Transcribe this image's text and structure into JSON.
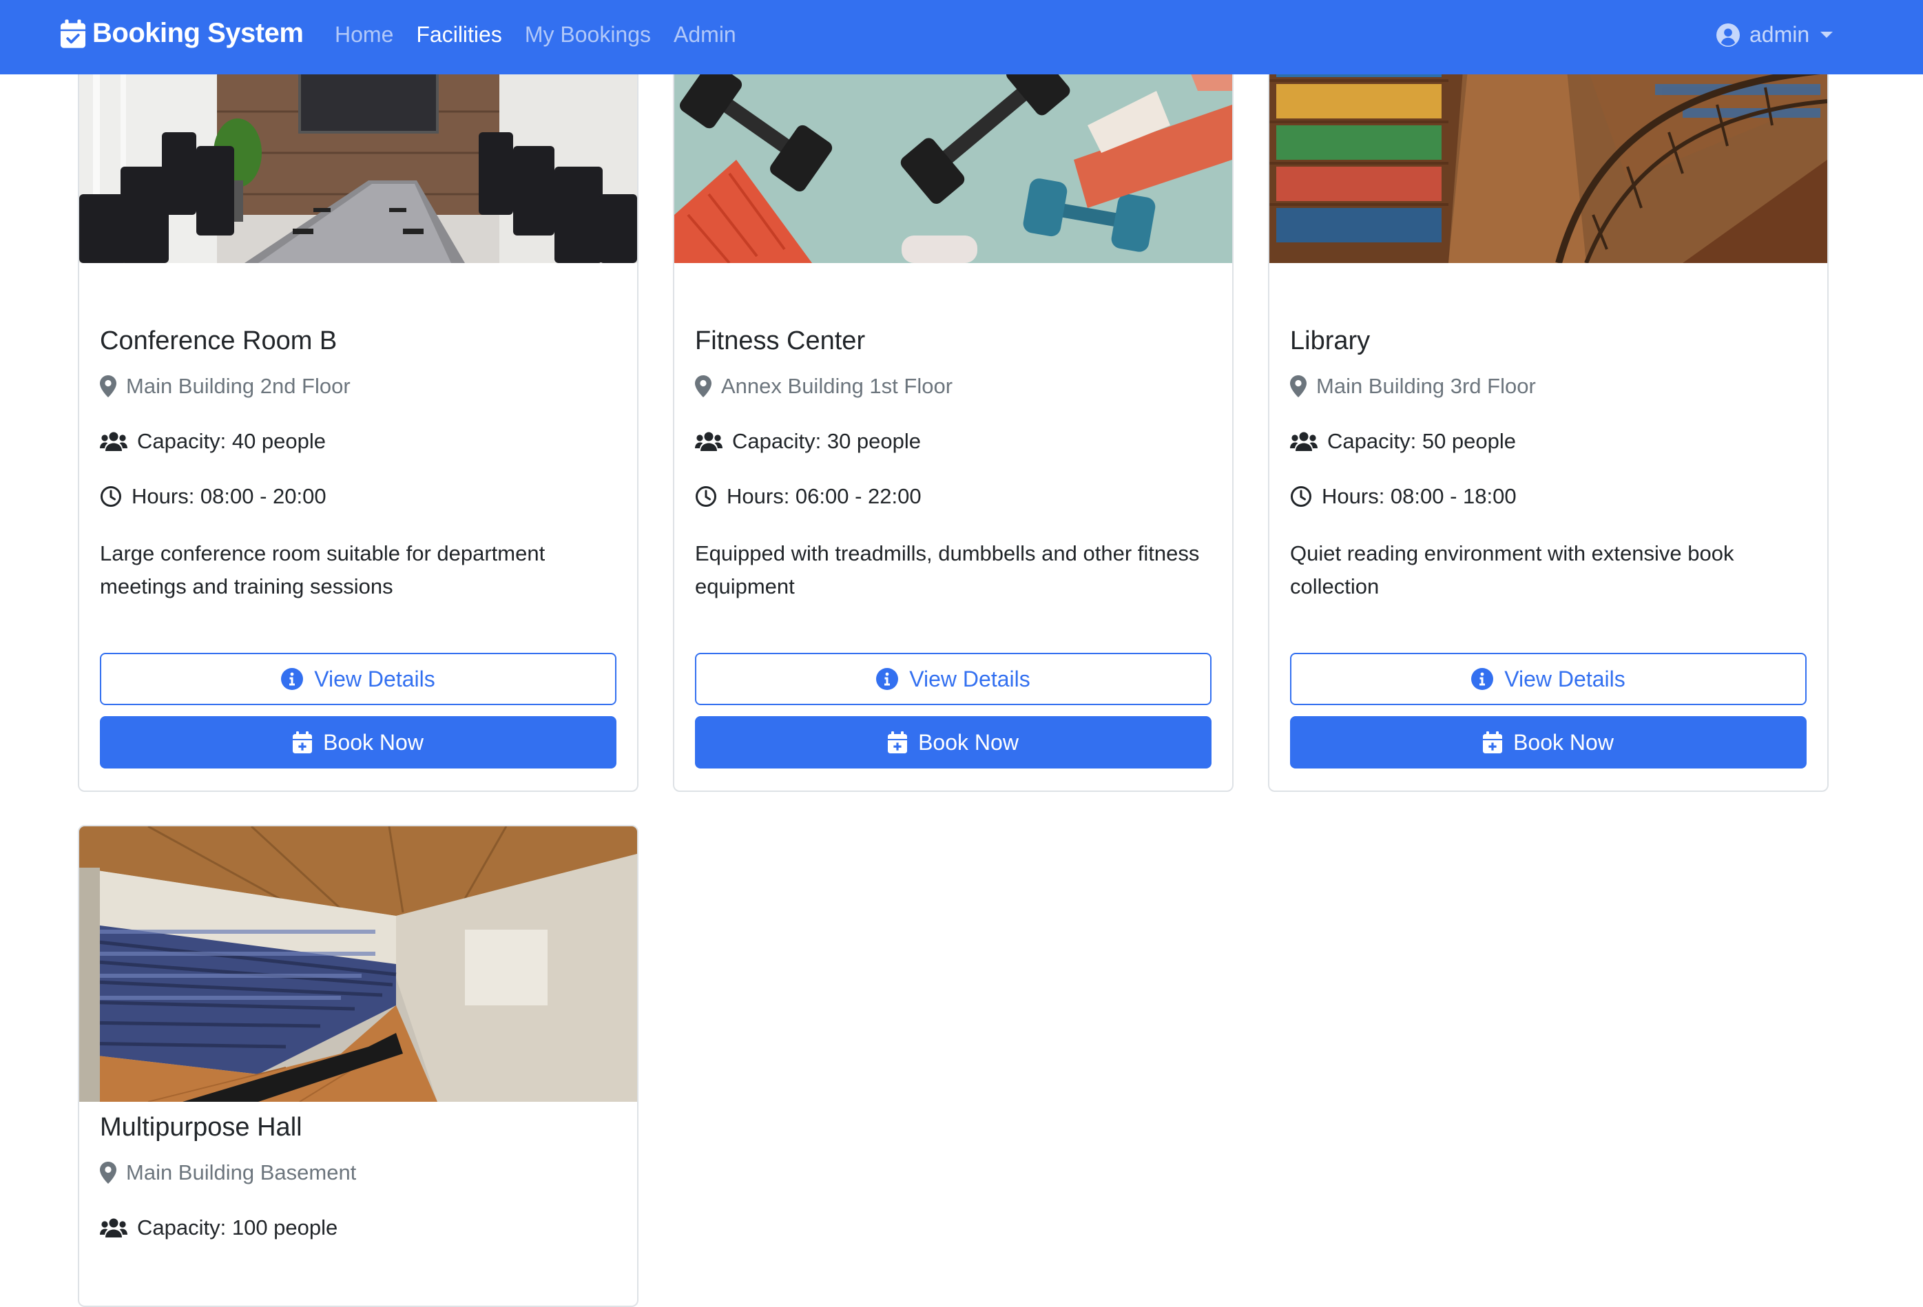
{
  "navbar": {
    "brand": "Booking System",
    "links": [
      {
        "label": "Home",
        "active": false
      },
      {
        "label": "Facilities",
        "active": true
      },
      {
        "label": "My Bookings",
        "active": false
      },
      {
        "label": "Admin",
        "active": false
      }
    ],
    "user": "admin"
  },
  "facilities": [
    {
      "name": "Conference Room B",
      "location": "Main Building 2nd Floor",
      "capacity": "Capacity: 40 people",
      "hours": "Hours: 08:00 - 20:00",
      "description": "Large conference room suitable for department meetings and training sessions",
      "details_label": "View Details",
      "book_label": "Book Now"
    },
    {
      "name": "Fitness Center",
      "location": "Annex Building 1st Floor",
      "capacity": "Capacity: 30 people",
      "hours": "Hours: 06:00 - 22:00",
      "description": "Equipped with treadmills, dumbbells and other fitness equipment",
      "details_label": "View Details",
      "book_label": "Book Now"
    },
    {
      "name": "Library",
      "location": "Main Building 3rd Floor",
      "capacity": "Capacity: 50 people",
      "hours": "Hours: 08:00 - 18:00",
      "description": "Quiet reading environment with extensive book collection",
      "details_label": "View Details",
      "book_label": "Book Now"
    },
    {
      "name": "Multipurpose Hall",
      "location": "Main Building Basement",
      "capacity": "Capacity: 100 people"
    }
  ],
  "colors": {
    "primary": "#3370f0",
    "muted": "#6c757d",
    "text": "#212529",
    "border": "#dee2e6"
  },
  "icons": {
    "brand": "calendar-check-icon",
    "user": "user-circle-icon",
    "location": "map-pin-icon",
    "capacity": "users-icon",
    "hours": "clock-icon",
    "details": "info-circle-icon",
    "book": "calendar-plus-icon"
  }
}
